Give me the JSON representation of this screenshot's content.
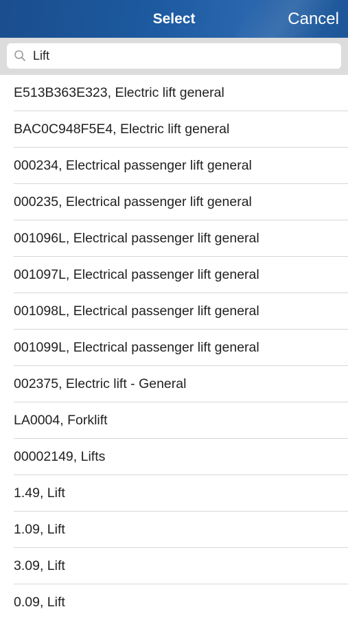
{
  "header": {
    "title": "Select",
    "cancel_label": "Cancel"
  },
  "search": {
    "value": "Lift",
    "icon": "search-icon"
  },
  "items": [
    "E513B363E323, Electric lift general",
    "BAC0C948F5E4, Electric lift general",
    "000234, Electrical passenger lift general",
    "000235, Electrical passenger lift general",
    "001096L, Electrical passenger lift general",
    "001097L, Electrical passenger lift general",
    "001098L, Electrical passenger lift general",
    "001099L, Electrical passenger lift general",
    "002375, Electric lift - General",
    "LA0004, Forklift",
    "00002149, Lifts",
    "1.49, Lift",
    "1.09, Lift",
    "3.09, Lift",
    "0.09, Lift"
  ],
  "colors": {
    "header_bg": "#1d5aa0",
    "search_bar_bg": "#dcdcdc",
    "divider": "#d6d6d6",
    "text": "#212121"
  }
}
